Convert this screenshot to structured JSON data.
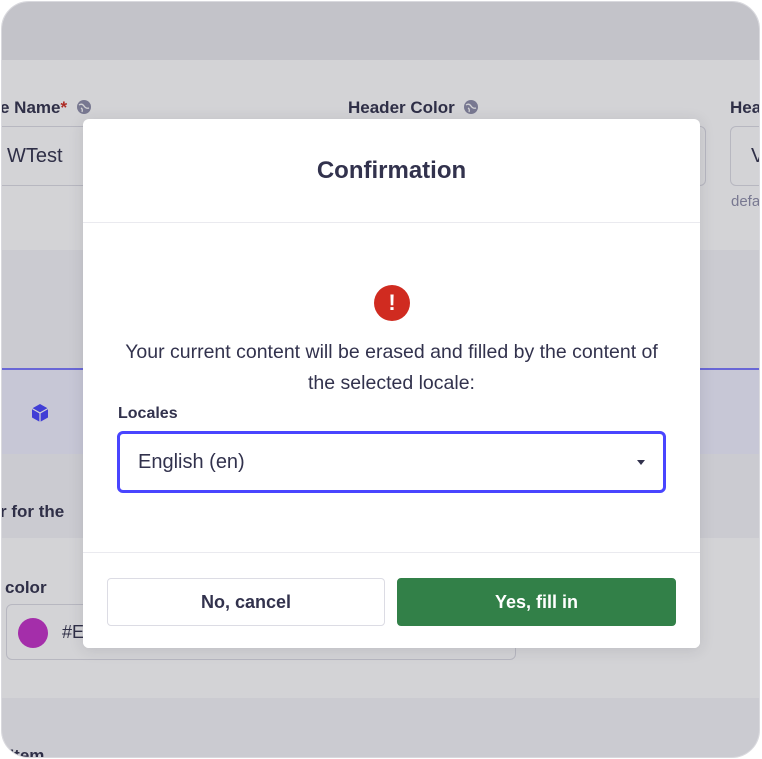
{
  "background": {
    "field1_label": "e Name",
    "field1_required": "*",
    "field1_value": "WTest",
    "field2_label": "Header Color",
    "field3_label": "Hea",
    "field3_value": "V",
    "field3_hint": "defa",
    "section_text": "r for the",
    "color_label": "color",
    "color_value": "#E",
    "bottom_text": "eItem",
    "swatch_color": "#c531c9"
  },
  "modal": {
    "title": "Confirmation",
    "alert_symbol": "!",
    "message": "Your current content will be erased and filled by the content of the selected locale:",
    "locales_label": "Locales",
    "selected_locale": "English (en)",
    "cancel_label": "No, cancel",
    "confirm_label": "Yes, fill in"
  },
  "colors": {
    "primary": "#4945ff",
    "success": "#328048",
    "danger": "#d02b20"
  }
}
